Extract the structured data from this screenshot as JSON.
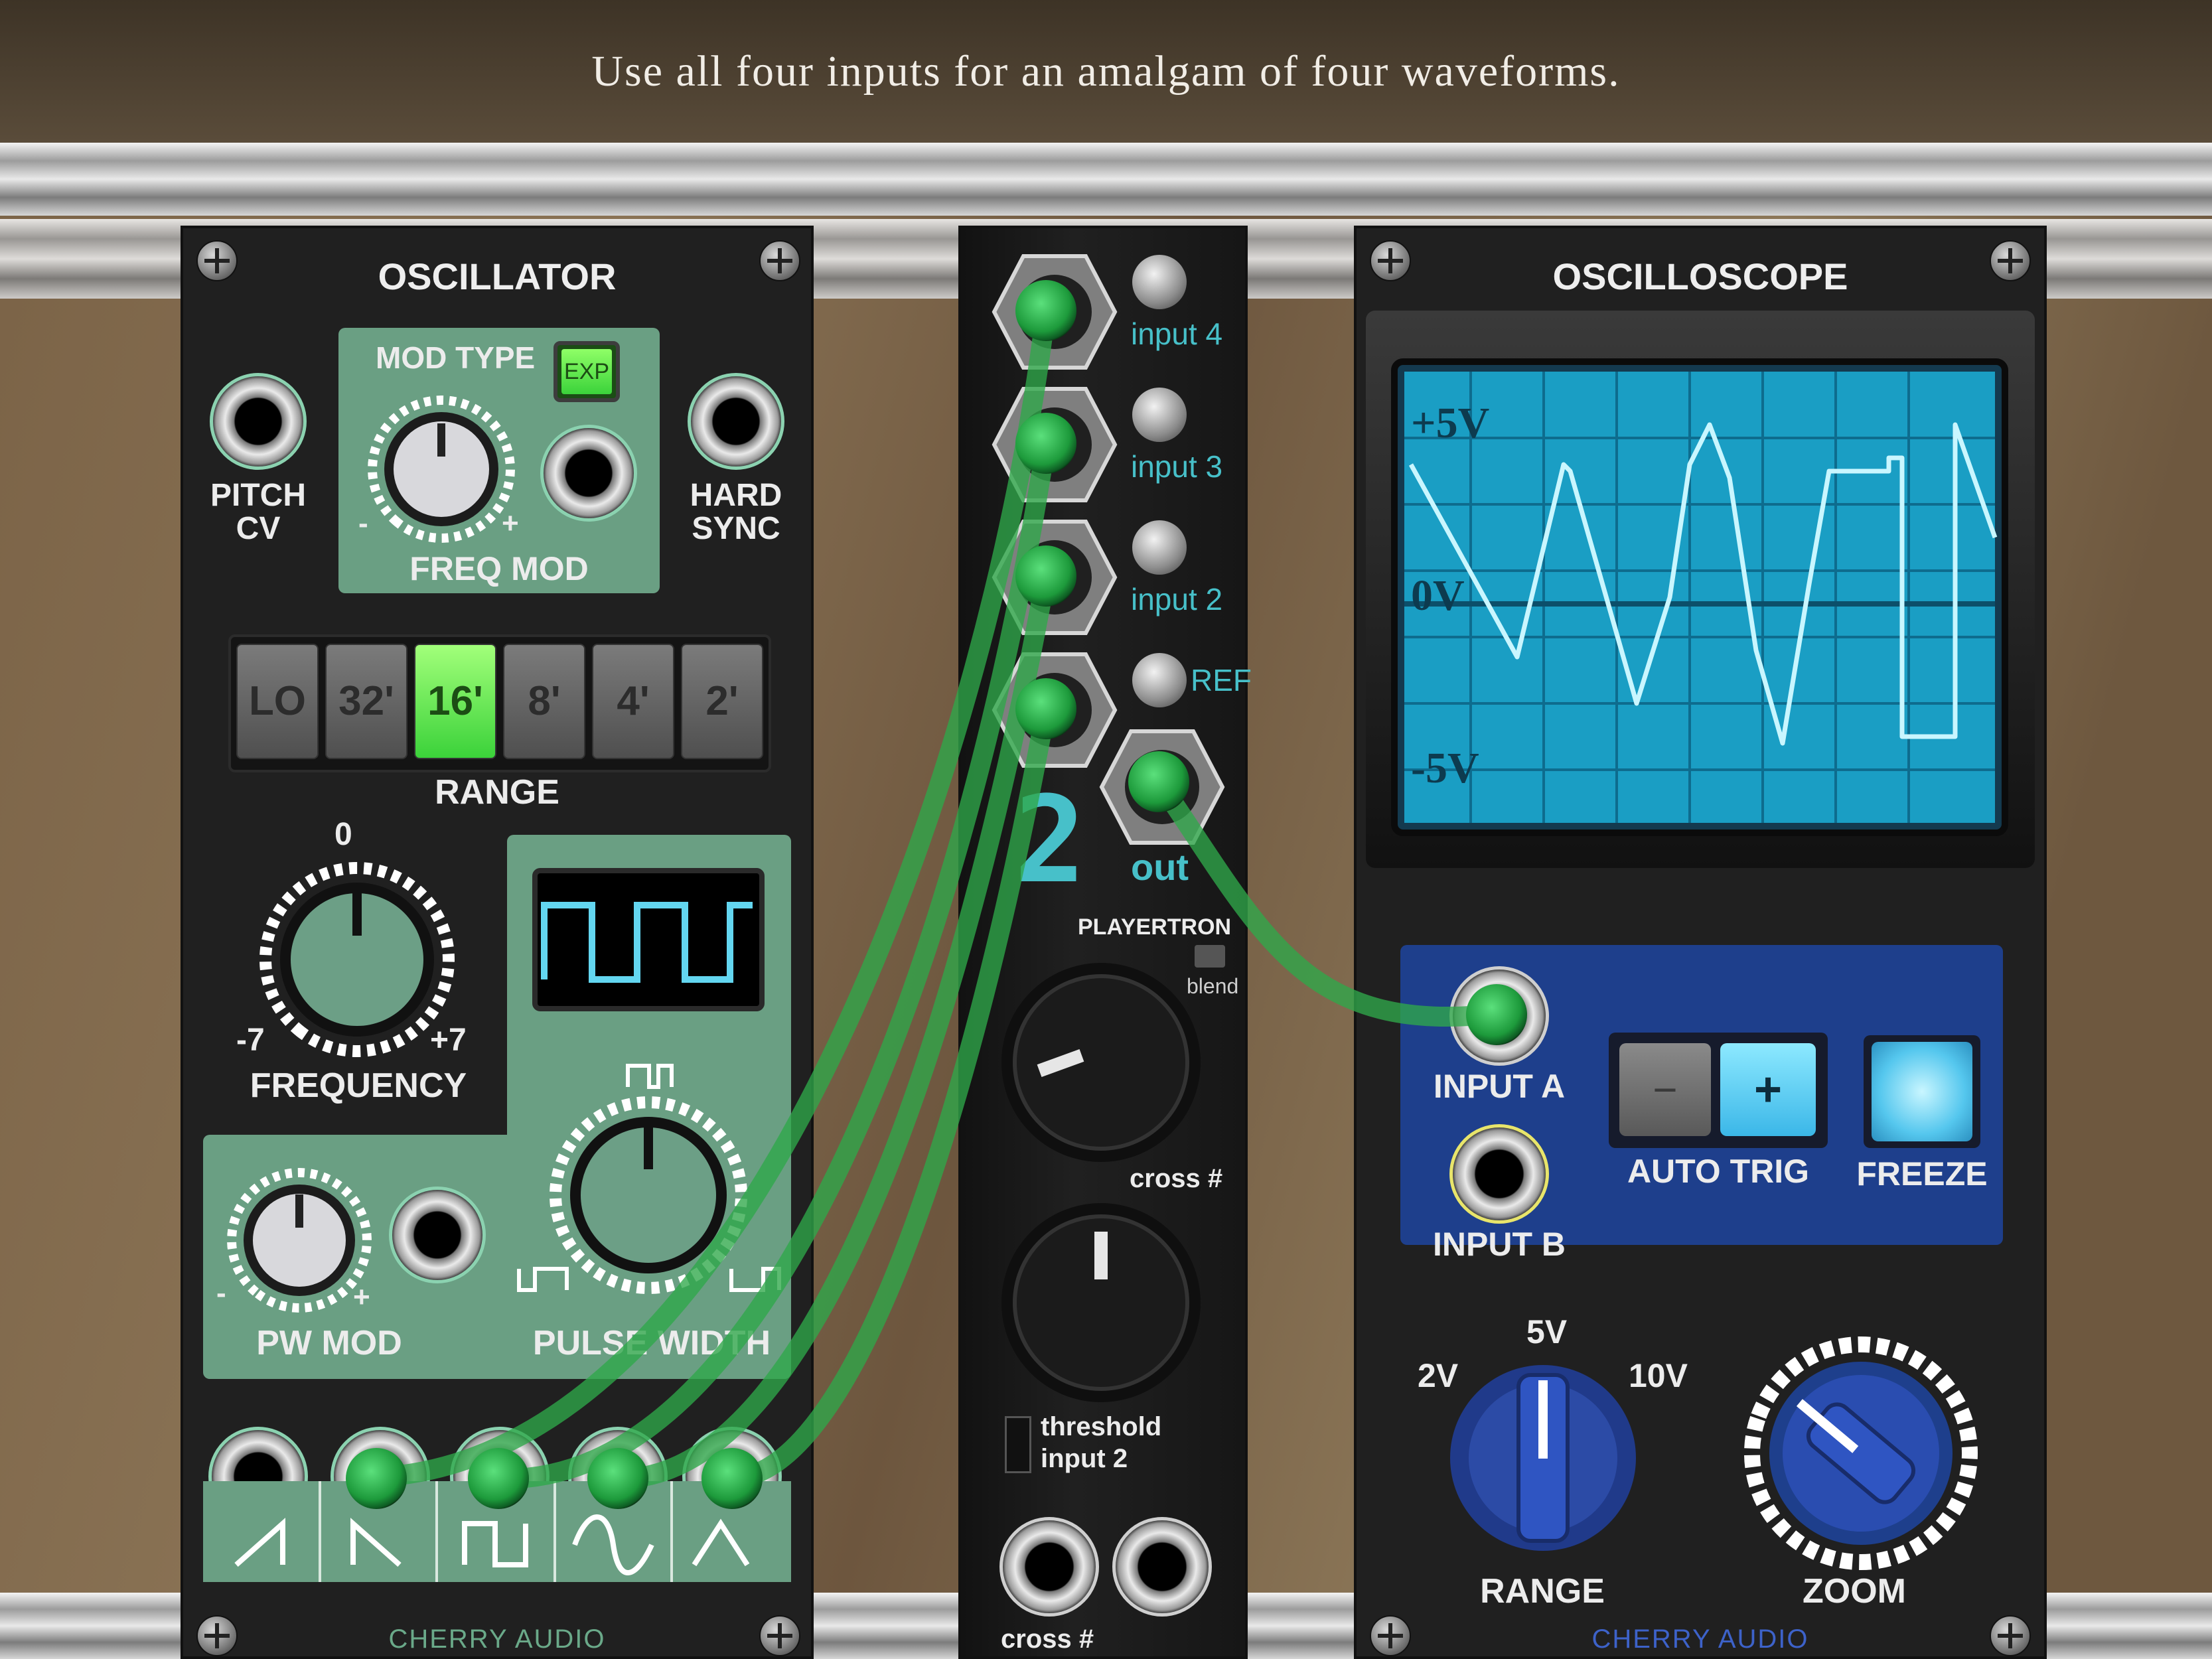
{
  "caption": "Use all four inputs for an amalgam of four waveforms.",
  "oscillator": {
    "title": "OSCILLATOR",
    "mod_type_label": "MOD TYPE",
    "exp_label": "EXP",
    "freq_mod_label": "FREQ MOD",
    "pitch_cv_line1": "PITCH",
    "pitch_cv_line2": "CV",
    "hard_sync_line1": "HARD",
    "hard_sync_line2": "SYNC",
    "range_label": "RANGE",
    "range_buttons": [
      "LO",
      "32'",
      "16'",
      "8'",
      "4'",
      "2'"
    ],
    "range_selected": "16'",
    "freq_zero": "0",
    "freq_min": "-7",
    "freq_max": "+7",
    "frequency_label": "FREQUENCY",
    "pw_mod_label": "PW MOD",
    "pulse_width_label": "PULSE WIDTH",
    "minus": "-",
    "plus": "+",
    "brand": "CHERRY AUDIO"
  },
  "playertron": {
    "inputs": [
      "input 4",
      "input 3",
      "input 2"
    ],
    "ref_label": "REF",
    "out_label": "out",
    "display_value": "2",
    "brand": "PLAYERTRON",
    "blend_label": "blend",
    "cross_label": "cross #",
    "threshold_line1": "threshold",
    "threshold_line2": "input 2",
    "bottom_label": "cross #"
  },
  "oscilloscope": {
    "title": "OSCILLOSCOPE",
    "y_labels": [
      "+5V",
      "0V",
      "-5V"
    ],
    "input_a_label": "INPUT A",
    "input_b_label": "INPUT B",
    "auto_trig_label": "AUTO TRIG",
    "minus": "−",
    "plus": "+",
    "freeze_label": "FREEZE",
    "range_label": "RANGE",
    "range_ticks": [
      "2V",
      "5V",
      "10V"
    ],
    "zoom_label": "ZOOM",
    "brand": "CHERRY AUDIO"
  },
  "colors": {
    "accent_green": "#3bd23a",
    "panel_green": "#6a9f83",
    "scope_blue": "#1e3f8c",
    "screen_cyan": "#1a9ec4",
    "cable_green": "#2fa84a"
  }
}
